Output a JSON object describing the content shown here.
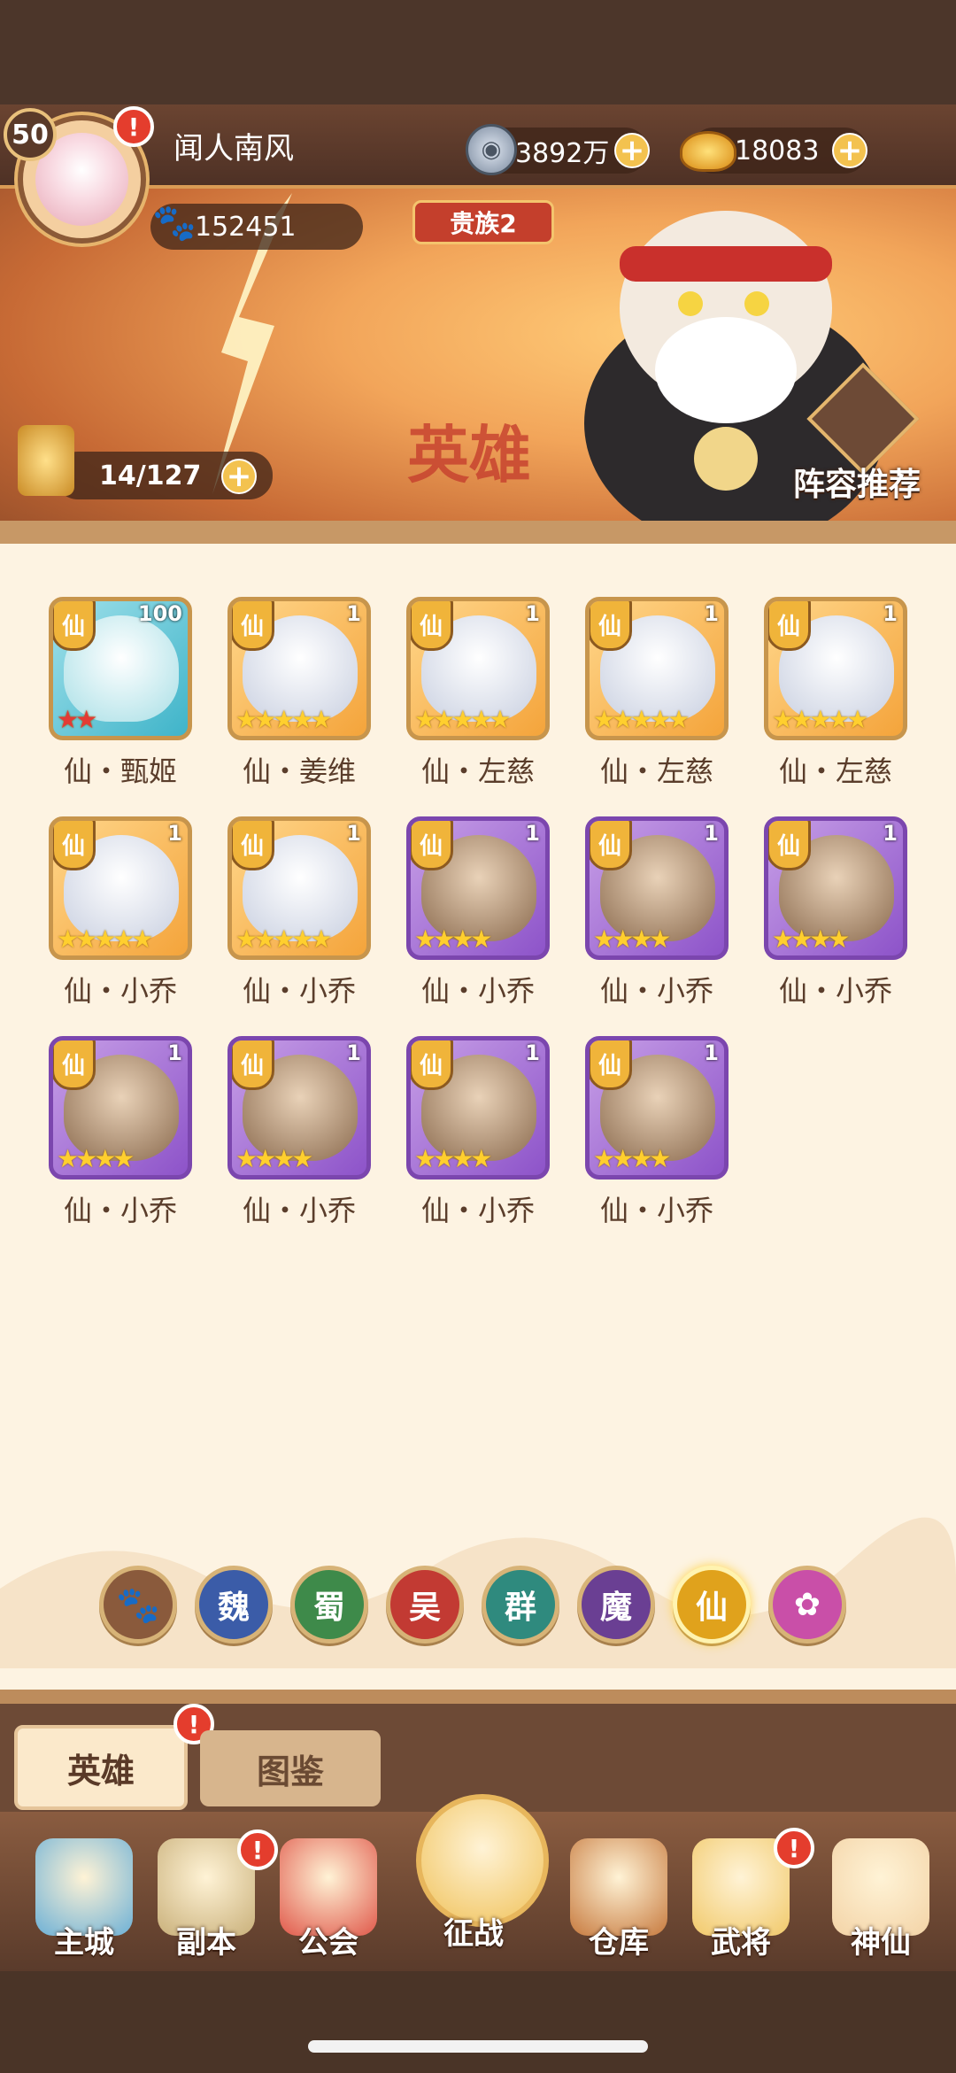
{
  "player": {
    "level": "50",
    "name": "闻人南风",
    "power": "152451",
    "noble": "贵族2",
    "alert": "!"
  },
  "currency": {
    "coins": "3892万",
    "gold": "18083"
  },
  "banner": {
    "hero_count": "14/127",
    "title_stamp": "英雄",
    "recommend_label": "阵容推荐"
  },
  "heroes": [
    {
      "faction_tag": "仙",
      "level": "100",
      "stars": "★★",
      "star_color": "red",
      "name": "仙・甄姬",
      "frame": "blue"
    },
    {
      "faction_tag": "仙",
      "level": "1",
      "stars": "★★★★★",
      "star_color": "gold",
      "name": "仙・姜维",
      "frame": "gold"
    },
    {
      "faction_tag": "仙",
      "level": "1",
      "stars": "★★★★★",
      "star_color": "gold",
      "name": "仙・左慈",
      "frame": "gold"
    },
    {
      "faction_tag": "仙",
      "level": "1",
      "stars": "★★★★★",
      "star_color": "gold",
      "name": "仙・左慈",
      "frame": "gold"
    },
    {
      "faction_tag": "仙",
      "level": "1",
      "stars": "★★★★★",
      "star_color": "gold",
      "name": "仙・左慈",
      "frame": "gold"
    },
    {
      "faction_tag": "仙",
      "level": "1",
      "stars": "★★★★★",
      "star_color": "gold",
      "name": "仙・小乔",
      "frame": "gold"
    },
    {
      "faction_tag": "仙",
      "level": "1",
      "stars": "★★★★★",
      "star_color": "gold",
      "name": "仙・小乔",
      "frame": "gold"
    },
    {
      "faction_tag": "仙",
      "level": "1",
      "stars": "★★★★",
      "star_color": "gold",
      "name": "仙・小乔",
      "frame": "purple"
    },
    {
      "faction_tag": "仙",
      "level": "1",
      "stars": "★★★★",
      "star_color": "gold",
      "name": "仙・小乔",
      "frame": "purple"
    },
    {
      "faction_tag": "仙",
      "level": "1",
      "stars": "★★★★",
      "star_color": "gold",
      "name": "仙・小乔",
      "frame": "purple"
    },
    {
      "faction_tag": "仙",
      "level": "1",
      "stars": "★★★★",
      "star_color": "gold",
      "name": "仙・小乔",
      "frame": "purple"
    },
    {
      "faction_tag": "仙",
      "level": "1",
      "stars": "★★★★",
      "star_color": "gold",
      "name": "仙・小乔",
      "frame": "purple"
    },
    {
      "faction_tag": "仙",
      "level": "1",
      "stars": "★★★★",
      "star_color": "gold",
      "name": "仙・小乔",
      "frame": "purple"
    },
    {
      "faction_tag": "仙",
      "level": "1",
      "stars": "★★★★",
      "star_color": "gold",
      "name": "仙・小乔",
      "frame": "purple"
    }
  ],
  "filters": [
    {
      "label": "",
      "icon": "paw-icon",
      "color": "#8a5a3c"
    },
    {
      "label": "魏",
      "color": "#3b5ca8"
    },
    {
      "label": "蜀",
      "color": "#3e8a4a"
    },
    {
      "label": "吴",
      "color": "#c23a33"
    },
    {
      "label": "群",
      "color": "#2f8a7e"
    },
    {
      "label": "魔",
      "color": "#6a3f93"
    },
    {
      "label": "仙",
      "color": "#e0a21c",
      "selected": true
    },
    {
      "label": "",
      "icon": "spirit-icon",
      "color": "#c94fa8"
    }
  ],
  "tabs": {
    "heroes": "英雄",
    "codex": "图鉴"
  },
  "nav": [
    {
      "label": "主城",
      "icon": "castle-icon"
    },
    {
      "label": "副本",
      "icon": "sword-icon"
    },
    {
      "label": "公会",
      "icon": "flag-icon"
    },
    {
      "label": "征战",
      "icon": "battle-icon"
    },
    {
      "label": "仓库",
      "icon": "pot-icon"
    },
    {
      "label": "武将",
      "icon": "general-icon"
    },
    {
      "label": "神仙",
      "icon": "cat-icon"
    }
  ]
}
